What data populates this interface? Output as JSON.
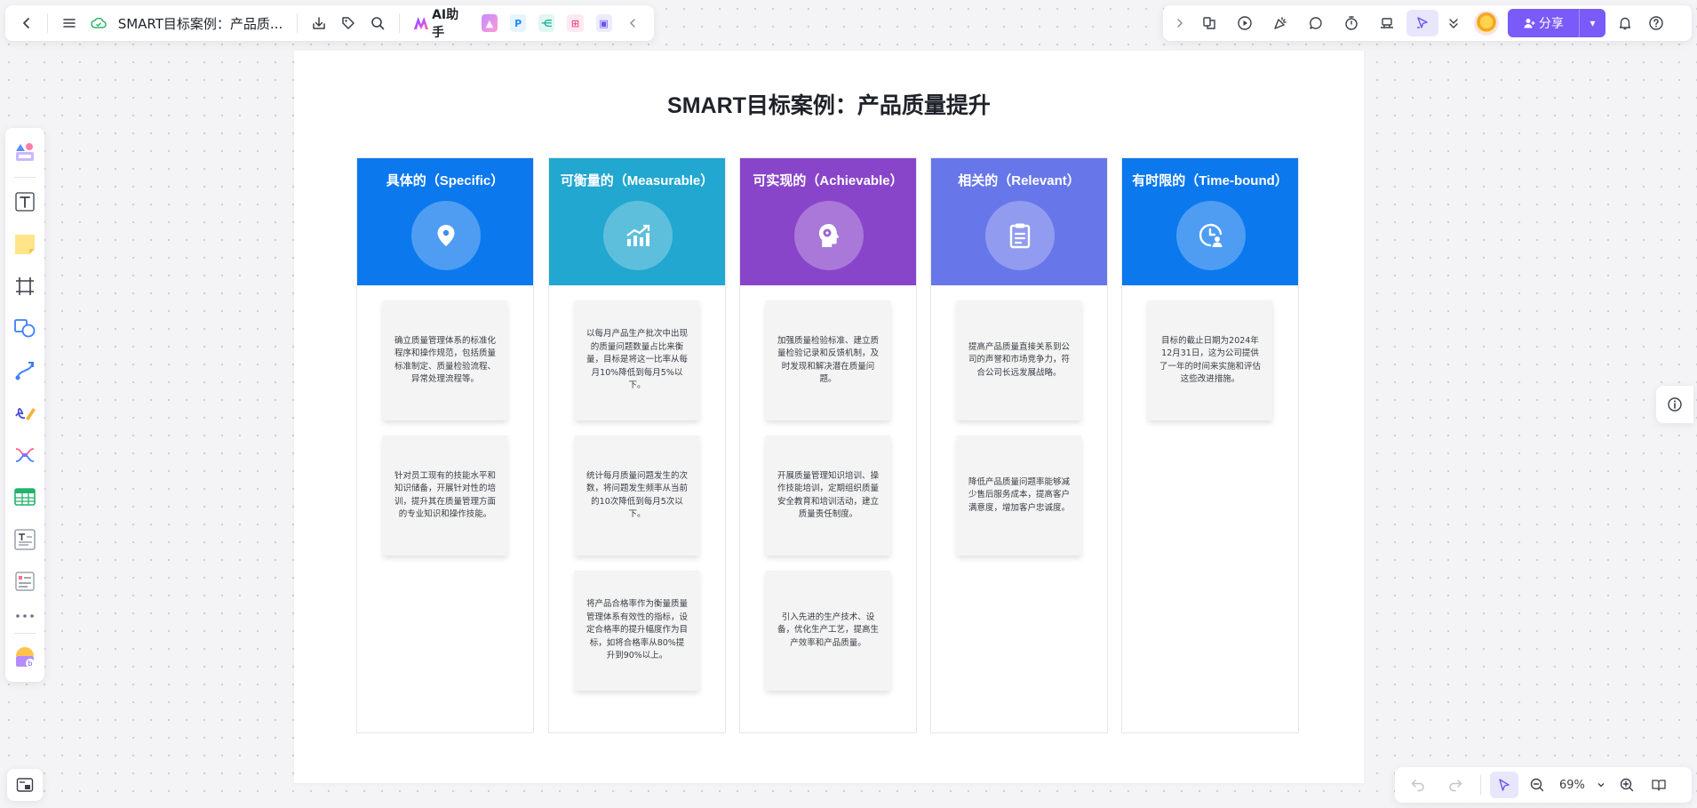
{
  "topbar": {
    "doc_title": "SMART目标案例：产品质...",
    "ai_label": "AI助手"
  },
  "share": {
    "label": "分享"
  },
  "zoom": {
    "level": "69%"
  },
  "board": {
    "title": "SMART目标案例：产品质量提升",
    "columns": [
      {
        "title": "具体的（Specific）",
        "color": "#0b78ee",
        "icon": "location-pin-icon",
        "notes": [
          "确立质量管理体系的标准化程序和操作规范，包括质量标准制定、质量检验流程、异常处理流程等。",
          "针对员工现有的技能水平和知识储备，开展针对性的培训，提升其在质量管理方面的专业知识和操作技能。"
        ]
      },
      {
        "title": "可衡量的（Measurable）",
        "color": "#21a7d0",
        "icon": "growth-chart-icon",
        "notes": [
          "以每月产品生产批次中出现的质量问题数量占比来衡量，目标是将这一比率从每月10%降低到每月5%以下。",
          "统计每月质量问题发生的次数，将问题发生频率从当前的10次降低到每月5次以下。",
          "将产品合格率作为衡量质量管理体系有效性的指标，设定合格率的提升幅度作为目标，如将合格率从80%提升到90%以上。"
        ]
      },
      {
        "title": "可实现的（Achievable）",
        "color": "#8945c9",
        "icon": "brain-head-icon",
        "notes": [
          "加强质量检验标准、建立质量检验记录和反馈机制，及时发现和解决潜在质量问题。",
          "开展质量管理知识培训、操作技能培训，定期组织质量安全教育和培训活动，建立质量责任制度。",
          "引入先进的生产技术、设备，优化生产工艺，提高生产效率和产品质量。"
        ]
      },
      {
        "title": "相关的（Relevant）",
        "color": "#6777ea",
        "icon": "clipboard-icon",
        "notes": [
          "提高产品质量直接关系到公司的声誉和市场竞争力，符合公司长远发展战略。",
          "降低产品质量问题率能够减少售后服务成本，提高客户满意度，增加客户忠诚度。"
        ]
      },
      {
        "title": "有时限的（Time-bound）",
        "color": "#0b78ee",
        "icon": "clock-user-icon",
        "notes": [
          "目标的截止日期为2024年12月31日，这为公司提供了一年的时间来实施和评估这些改进措施。"
        ]
      }
    ]
  }
}
